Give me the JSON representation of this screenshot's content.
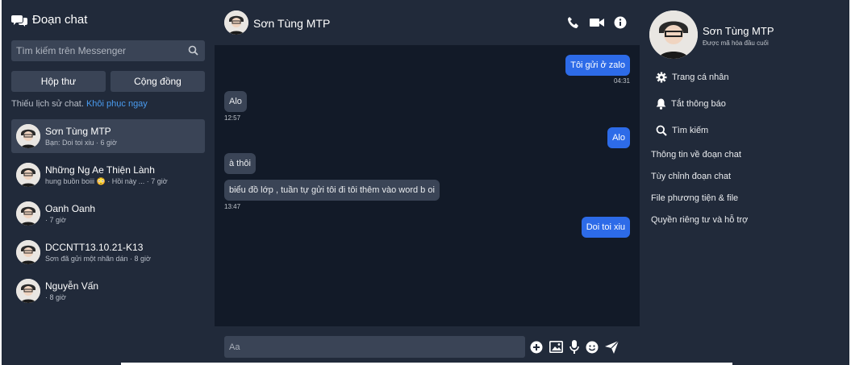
{
  "sidebar": {
    "title": "Đoạn chat",
    "search_placeholder": "Tìm kiếm trên Messenger",
    "tabs": [
      "Hộp thư",
      "Cộng đồng"
    ],
    "history_text": "Thiếu lịch sử chat.",
    "history_link": "Khôi phục ngay",
    "conversations": [
      {
        "name": "Sơn Tùng MTP",
        "sub": "Bạn: Doi toi xiu · 6 giờ"
      },
      {
        "name": "Những Ng Ae Thiện Lành",
        "sub": "hung buồn boiii 😳 · Hồi này ... · 7 giờ"
      },
      {
        "name": "Oanh Oanh",
        "sub": "· 7 giờ"
      },
      {
        "name": "DCCNTT13.10.21-K13",
        "sub": "Sơn đã gửi một nhãn dán · 8 giờ"
      },
      {
        "name": "Nguyễn Vấn",
        "sub": "· 8 giờ"
      }
    ]
  },
  "chat": {
    "contact_name": "Sơn Tùng MTP",
    "messages": [
      {
        "text": "Tôi gửi ở zalo",
        "dir": "out",
        "time": "04:31"
      },
      {
        "text": "Alo",
        "dir": "in",
        "time": "12:57"
      },
      {
        "text": "Alo",
        "dir": "out",
        "time": ""
      },
      {
        "text": "à thôi",
        "dir": "in",
        "time": ""
      },
      {
        "text": "biểu đồ lớp , tuần tự gửi tôi đi tôi thêm vào word b oi",
        "dir": "in",
        "time": "13:47"
      },
      {
        "text": "Doi toi xiu",
        "dir": "out",
        "time": ""
      }
    ],
    "compose_placeholder": "Aa"
  },
  "info": {
    "name": "Sơn Tùng MTP",
    "encryption": "Được mã hóa đầu cuối",
    "menu": [
      {
        "label": "Trang cá nhân",
        "icon": "gear-icon"
      },
      {
        "label": "Tắt thông báo",
        "icon": "bell-icon"
      },
      {
        "label": "Tìm kiếm",
        "icon": "search-icon"
      },
      {
        "label": "Thông tin về đoạn chat",
        "icon": ""
      },
      {
        "label": "Tùy chỉnh đoạn chat",
        "icon": ""
      },
      {
        "label": "File phương tiện & file",
        "icon": ""
      },
      {
        "label": "Quyền riêng tư và hỗ trợ",
        "icon": ""
      }
    ]
  },
  "colors": {
    "background": "#212a3a",
    "chat_background": "#121a28",
    "outgoing_bubble": "#2d6be8",
    "incoming_bubble": "#3a4456",
    "link": "#4a9cf0"
  }
}
